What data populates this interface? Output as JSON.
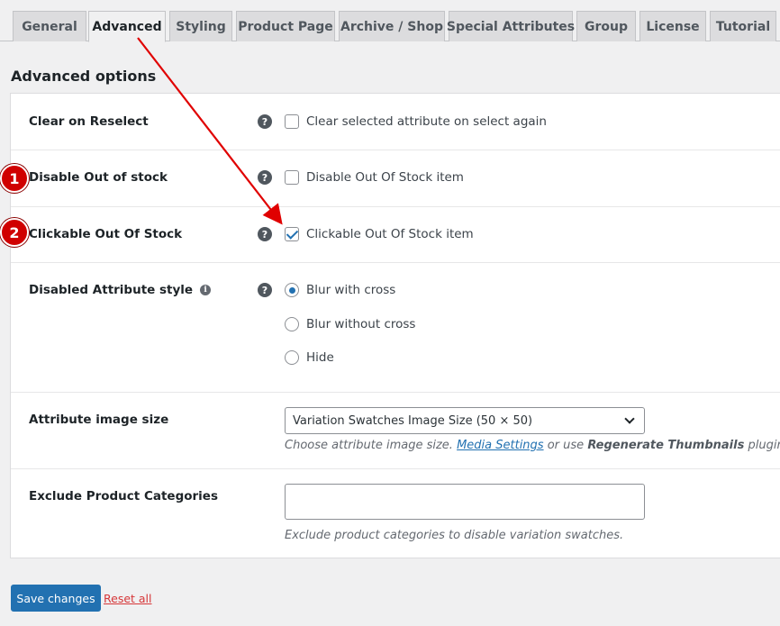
{
  "tabs": [
    {
      "label": "General"
    },
    {
      "label": "Advanced"
    },
    {
      "label": "Styling"
    },
    {
      "label": "Product Page"
    },
    {
      "label": "Archive / Shop"
    },
    {
      "label": "Special Attributes"
    },
    {
      "label": "Group"
    },
    {
      "label": "License"
    },
    {
      "label": "Tutorial"
    }
  ],
  "active_tab": "Advanced",
  "section_title": "Advanced options",
  "rows": {
    "clear_on_reselect": {
      "label": "Clear on Reselect",
      "option": "Clear selected attribute on select again",
      "checked": false
    },
    "disable_out_of_stock": {
      "label": "Disable Out of stock",
      "option": "Disable Out Of Stock item",
      "checked": false
    },
    "clickable_out_of_stock": {
      "label": "Clickable Out Of Stock",
      "option": "Clickable Out Of Stock item",
      "checked": true
    },
    "disabled_attribute_style": {
      "label": "Disabled Attribute style",
      "options": [
        "Blur with cross",
        "Blur without cross",
        "Hide"
      ],
      "selected": "Blur with cross"
    },
    "attribute_image_size": {
      "label": "Attribute image size",
      "selected": "Variation Swatches Image Size (50 × 50)",
      "desc_prefix": "Choose attribute image size.",
      "desc_link": "Media Settings",
      "desc_mid": "or use",
      "desc_bold": "Regenerate Thumbnails",
      "desc_suffix": "plugin"
    },
    "exclude_product_categories": {
      "label": "Exclude Product Categories",
      "value": "",
      "desc": "Exclude product categories to disable variation swatches."
    }
  },
  "help_glyph": "?",
  "info_glyph": "i",
  "buttons": {
    "save": "Save changes",
    "reset": "Reset all"
  },
  "annotations": {
    "badge_1": "1",
    "badge_2": "2",
    "color": "#d00000"
  },
  "colors": {
    "primary": "#2271b1",
    "danger": "#d63638"
  }
}
